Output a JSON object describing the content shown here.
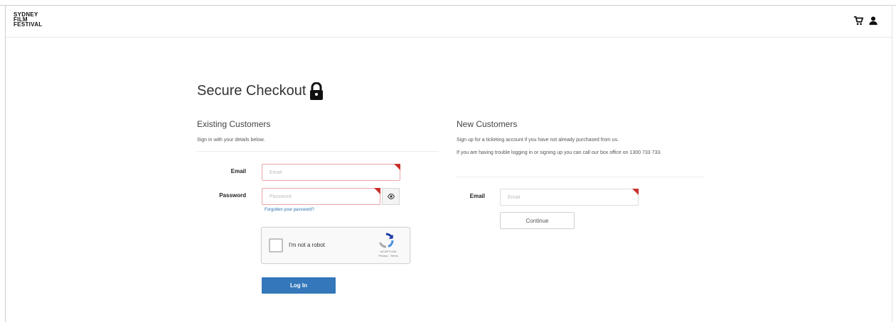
{
  "header": {
    "logo_lines": [
      "SYDNEY",
      "FILM",
      "FESTIVAL"
    ],
    "icons": [
      "cart-icon",
      "user-icon"
    ]
  },
  "page": {
    "title": "Secure Checkout",
    "title_icon": "lock-icon"
  },
  "existing": {
    "title": "Existing Customers",
    "subtitle": "Sign in with your details below.",
    "email_label": "Email",
    "email_placeholder": "Email",
    "email_value": "",
    "password_label": "Password",
    "password_placeholder": "Password",
    "password_value": "",
    "eye_icon": "eye-icon",
    "forgot_link": "Forgotten your password?",
    "captcha_text": "I'm not a robot",
    "captcha_brand": "reCAPTCHA",
    "captcha_links": "Privacy - Terms",
    "login_button": "Log In"
  },
  "new": {
    "title": "New Customers",
    "text1": "Sign up for a ticketing account if you have not already purchased from us.",
    "text2": "If you are having trouble logging in or signing up you can call our box office on 1300 733 733.",
    "email_label": "Email",
    "email_placeholder": "Email",
    "email_value": "",
    "continue_button": "Continue"
  },
  "colors": {
    "required_marker": "#c9302c",
    "invalid_border": "#e8a6a6",
    "primary_button": "#3477ba",
    "link": "#2a6fb0"
  }
}
